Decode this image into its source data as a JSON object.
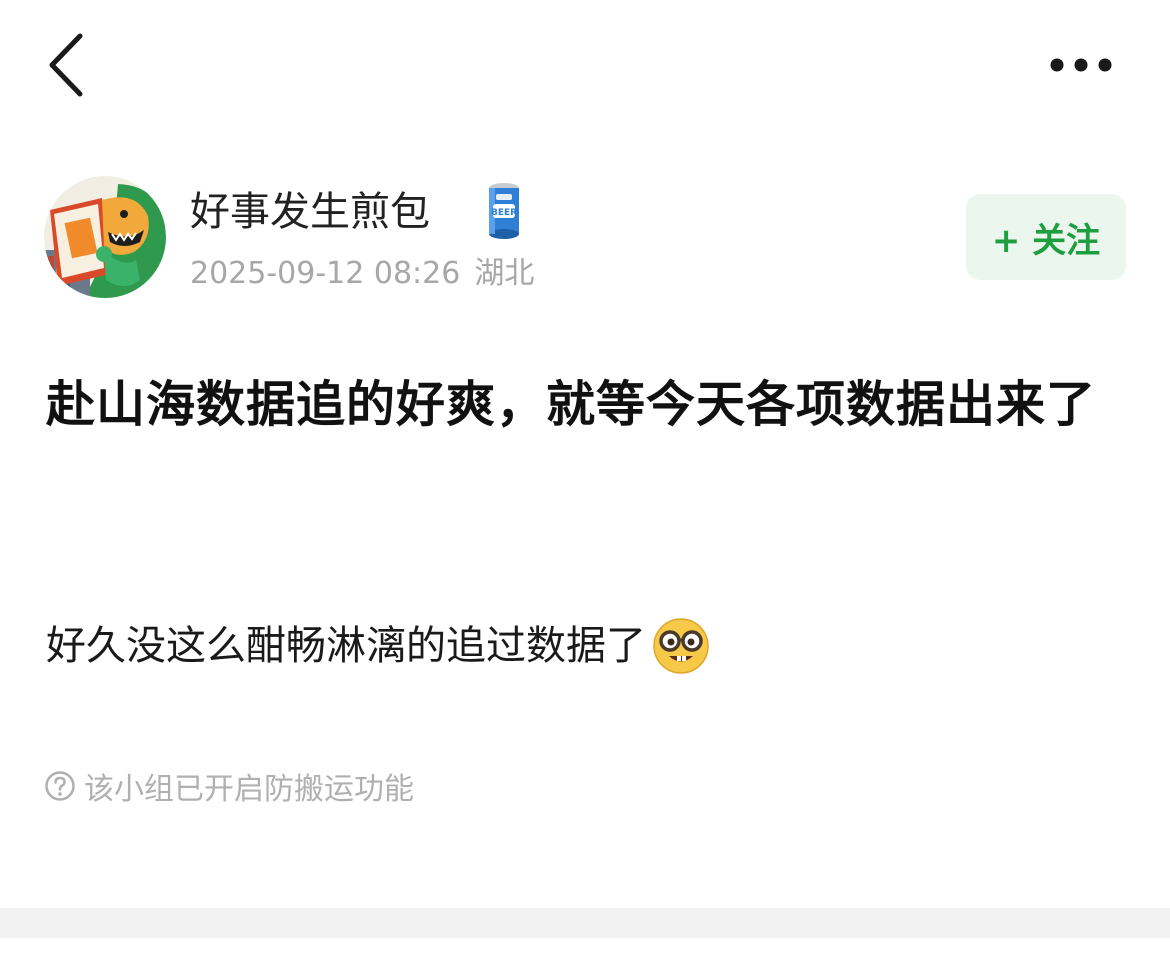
{
  "header": {
    "back_icon": "chevron-left-icon",
    "more_icon": "more-horizontal-icon"
  },
  "author": {
    "name": "好事发生煎包",
    "badge_icon": "beer-can-icon",
    "date": "2025-09-12 08:26",
    "location": "湖北",
    "follow_label": "+ 关注"
  },
  "post": {
    "title": "赴山海数据追的好爽，就等今天各项数据出来了",
    "body": "好久没这么酣畅淋漓的追过数据了",
    "body_emoji": "nerd-face-icon"
  },
  "notice": {
    "icon": "question-circle-icon",
    "text": "该小组已开启防搬运功能"
  },
  "colors": {
    "accent_green": "#1e9e3f",
    "follow_bg": "#ebf7ee",
    "meta_gray": "#a7a7a7"
  }
}
